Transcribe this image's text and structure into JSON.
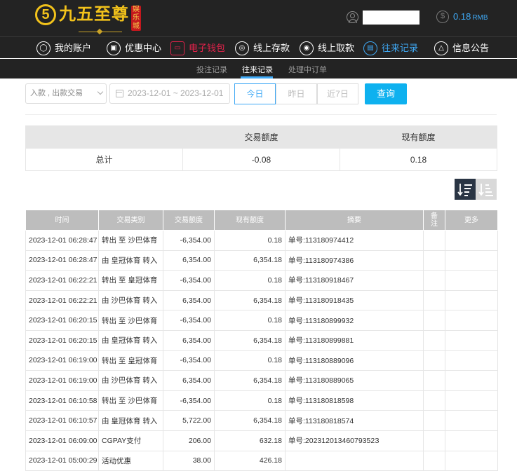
{
  "header": {
    "logo_number": "5",
    "logo_text": "九五至尊",
    "logo_badge": "娱乐城",
    "balance_symbol": "$",
    "balance_amount": "0.18",
    "balance_currency": "RMB"
  },
  "nav": [
    {
      "label": "我的账户",
      "icon": "user-icon",
      "glyph": "◯"
    },
    {
      "label": "优惠中心",
      "icon": "gift-icon",
      "glyph": "▣"
    },
    {
      "label": "电子钱包",
      "icon": "wallet-icon",
      "glyph": "▭"
    },
    {
      "label": "线上存款",
      "icon": "deposit-icon",
      "glyph": "◎"
    },
    {
      "label": "线上取款",
      "icon": "withdraw-icon",
      "glyph": "◉"
    },
    {
      "label": "往来记录",
      "icon": "records-icon",
      "glyph": "▤"
    },
    {
      "label": "信息公告",
      "icon": "bell-icon",
      "glyph": "△"
    }
  ],
  "subnav": [
    {
      "label": "投注记录"
    },
    {
      "label": "往来记录"
    },
    {
      "label": "处理中订单"
    }
  ],
  "filters": {
    "type_select": "入款 , 出款交易",
    "date_range": "2023-12-01 ~ 2023-12-01",
    "quick": [
      "今日",
      "昨日",
      "近7日"
    ],
    "search_label": "查询"
  },
  "summary": {
    "headers": [
      "",
      "交易额度",
      "现有额度"
    ],
    "row": [
      "总计",
      "-0.08",
      "0.18"
    ]
  },
  "colors": {
    "accent": "#3fa9f5",
    "active_nav": "#e5224b",
    "search": "#0eb1ef"
  },
  "records": {
    "headers": [
      "时间",
      "交易类别",
      "交易额度",
      "现有额度",
      "摘要",
      "备注",
      "更多"
    ],
    "rows": [
      [
        "2023-12-01 06:28:47",
        "转出 至 沙巴体育",
        "-6,354.00",
        "0.18",
        "单号:113180974412"
      ],
      [
        "2023-12-01 06:28:47",
        "由 皇冠体育 转入",
        "6,354.00",
        "6,354.18",
        "单号:113180974386"
      ],
      [
        "2023-12-01 06:22:21",
        "转出 至 皇冠体育",
        "-6,354.00",
        "0.18",
        "单号:113180918467"
      ],
      [
        "2023-12-01 06:22:21",
        "由 沙巴体育 转入",
        "6,354.00",
        "6,354.18",
        "单号:113180918435"
      ],
      [
        "2023-12-01 06:20:15",
        "转出 至 沙巴体育",
        "-6,354.00",
        "0.18",
        "单号:113180899932"
      ],
      [
        "2023-12-01 06:20:15",
        "由 皇冠体育 转入",
        "6,354.00",
        "6,354.18",
        "单号:113180899881"
      ],
      [
        "2023-12-01 06:19:00",
        "转出 至 皇冠体育",
        "-6,354.00",
        "0.18",
        "单号:113180889096"
      ],
      [
        "2023-12-01 06:19:00",
        "由 沙巴体育 转入",
        "6,354.00",
        "6,354.18",
        "单号:113180889065"
      ],
      [
        "2023-12-01 06:10:58",
        "转出 至 沙巴体育",
        "-6,354.00",
        "0.18",
        "单号:113180818598"
      ],
      [
        "2023-12-01 06:10:57",
        "由 皇冠体育 转入",
        "5,722.00",
        "6,354.18",
        "单号:113180818574"
      ],
      [
        "2023-12-01 06:09:00",
        "CGPAY支付",
        "206.00",
        "632.18",
        "单号:20231201346079352З"
      ],
      [
        "2023-12-01 05:00:29",
        "活动优惠",
        "38.00",
        "426.18",
        ""
      ]
    ]
  }
}
